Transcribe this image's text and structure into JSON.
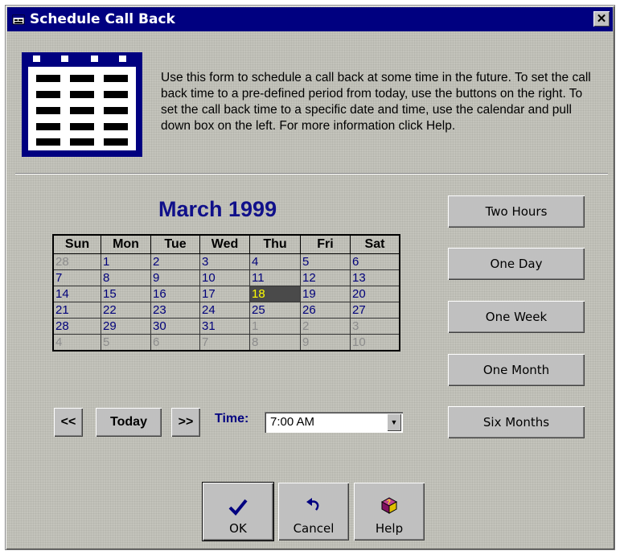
{
  "window": {
    "title": "Schedule Call Back",
    "close_glyph": "✕"
  },
  "description": "Use this form to schedule a call back at some time in the future. To set the call back time to a pre-defined period from today, use the buttons on the right. To set the call back time to a specific date and time, use the calendar and pull down box on the left. For more information click Help.",
  "calendar": {
    "month_label": "March 1999",
    "weekdays": [
      "Sun",
      "Mon",
      "Tue",
      "Wed",
      "Thu",
      "Fri",
      "Sat"
    ],
    "weeks": [
      [
        "28",
        "1",
        "2",
        "3",
        "4",
        "5",
        "6"
      ],
      [
        "7",
        "8",
        "9",
        "10",
        "11",
        "12",
        "13"
      ],
      [
        "14",
        "15",
        "16",
        "17",
        "18",
        "19",
        "20"
      ],
      [
        "21",
        "22",
        "23",
        "24",
        "25",
        "26",
        "27"
      ],
      [
        "28",
        "29",
        "30",
        "31",
        "1",
        "2",
        "3"
      ],
      [
        "4",
        "5",
        "6",
        "7",
        "8",
        "9",
        "10"
      ]
    ],
    "selected_day": "18",
    "nav": {
      "prev": "<<",
      "today": "Today",
      "next": ">>"
    }
  },
  "time": {
    "label": "Time:",
    "value": "7:00 AM"
  },
  "presets": [
    "Two Hours",
    "One Day",
    "One Week",
    "One Month",
    "Six Months"
  ],
  "actions": {
    "ok": "OK",
    "cancel": "Cancel",
    "help": "Help"
  },
  "colors": {
    "title_bar": "#000080",
    "selected_day_bg": "#4a4a4a",
    "selected_day_text": "#ffff00",
    "day_text": "#00007a",
    "other_month_text": "#8c8c8c"
  },
  "icons": {
    "window": "app-window-icon",
    "calendar": "calendar-icon",
    "ok": "checkmark-icon",
    "cancel": "undo-arrow-icon",
    "help": "help-book-icon"
  }
}
